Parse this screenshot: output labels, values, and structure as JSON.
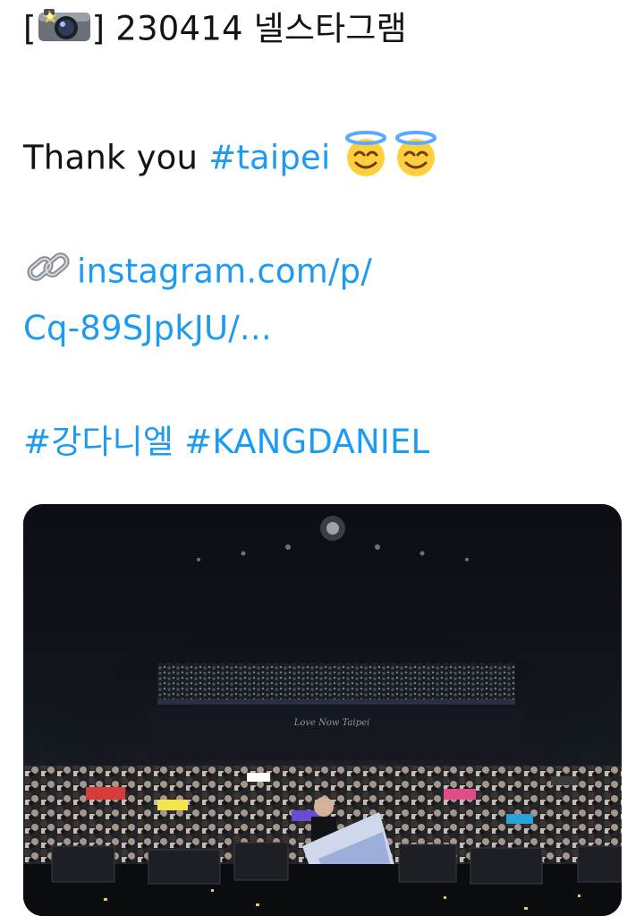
{
  "tweet": {
    "title_prefix": "[",
    "title_suffix": "] 230414 넬스타그램",
    "thank_you": "Thank you ",
    "hashtag_taipei": "#taipei",
    "link_line1": "instagram.com/p/",
    "link_line2": "Cq-89SJpkJU/...",
    "hashtag_kang_ko": "#강다니엘",
    "hashtag_kang_en": "#KANGDANIEL",
    "icons": {
      "camera": "camera-with-flash-icon",
      "smile": "smiling-face-with-halo-icon",
      "link": "link-icon"
    },
    "colors": {
      "text": "#0f1419",
      "link": "#1d9bf0"
    }
  },
  "photo": {
    "banner_text": "Love Now Taipei"
  }
}
